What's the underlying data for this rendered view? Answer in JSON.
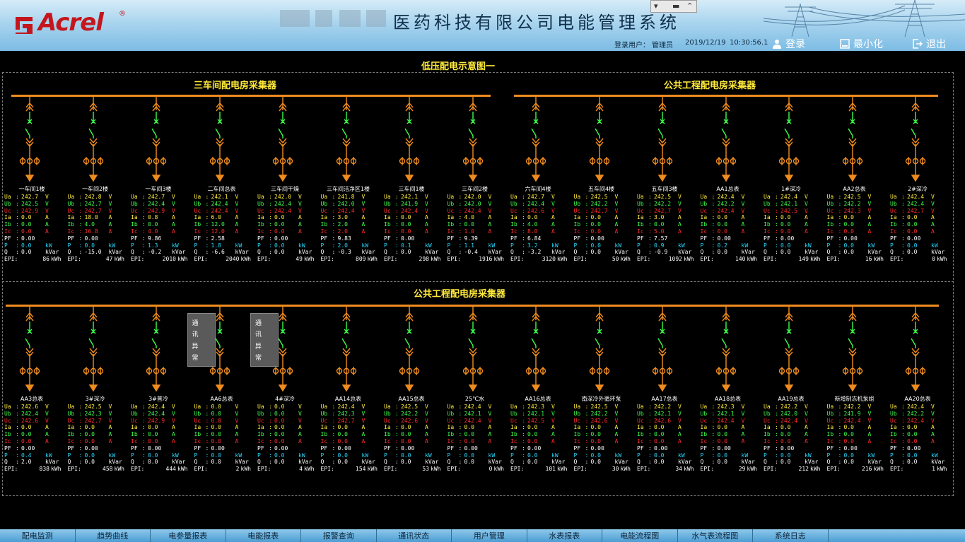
{
  "header": {
    "logo_text": "Acrel",
    "logo_mark": "®",
    "app_title": "医药科技有限公司电能管理系统",
    "login_user_label": "登录用户：",
    "login_user": "管理员",
    "date": "2019/12/19",
    "time": "10:30:56.1",
    "login_button": "登录",
    "minimize_button": "最小化",
    "exit_button": "退出"
  },
  "page_title": "低压配电示意图一",
  "sections": [
    {
      "title": "三车间配电房采集器"
    },
    {
      "title": "公共工程配电房采集器"
    },
    {
      "title": "公共工程配电房采集器"
    }
  ],
  "alert_text": [
    "通",
    "讯",
    "异",
    "常"
  ],
  "labels": {
    "ua": "Ua",
    "ub": "Ub",
    "uc": "Uc",
    "ia": "Ia",
    "ib": "Ib",
    "ic": "Ic",
    "pf": "PF",
    "p": "P",
    "q": "Q",
    "epi": "EPI:",
    "v": "V",
    "a": "A",
    "kw": "kW",
    "kvar": "kVar",
    "kwh": "kWh"
  },
  "row1": [
    {
      "name": "一车间1楼",
      "ua": "242.7",
      "ub": "242.5",
      "uc": "242.9",
      "ia": "0.0",
      "ib": "0.0",
      "ic": "0.0",
      "pf": "0.00",
      "p": "0.0",
      "q": "0.0",
      "epi": "86"
    },
    {
      "name": "一车间2楼",
      "ua": "242.8",
      "ub": "242.7",
      "uc": "242.7",
      "ia": "18.0",
      "ib": "4.0",
      "ic": "16.8",
      "pf": "0.00",
      "p": "0.0",
      "q": "-15.0",
      "epi": "47"
    },
    {
      "name": "一车间3楼",
      "ua": "242.7",
      "ub": "242.4",
      "uc": "242.9",
      "ia": "0.8",
      "ib": "0.0",
      "ic": "4.0",
      "pf": "9.86",
      "p": "1.3",
      "q": "-0.2",
      "epi": "2010"
    },
    {
      "name": "二车间总表",
      "ua": "242.1",
      "ub": "242.4",
      "uc": "242.4",
      "ia": "6.0",
      "ib": "12.0",
      "ic": "12.0",
      "pf": "2.58",
      "p": "1.8",
      "q": "-6.6",
      "epi": "2040"
    },
    {
      "name": "三车间干燥",
      "ua": "242.0",
      "ub": "242.4",
      "uc": "242.4",
      "ia": "0.0",
      "ib": "0.0",
      "ic": "0.0",
      "pf": "0.00",
      "p": "0.0",
      "q": "0.0",
      "epi": "49"
    },
    {
      "name": "三车间洁净区1楼",
      "ua": "241.8",
      "ub": "242.0",
      "uc": "242.4",
      "ia": "3.0",
      "ib": "2.0",
      "ic": "2.0",
      "pf": "9.83",
      "p": "2.0",
      "q": "-0.3",
      "epi": "809"
    },
    {
      "name": "三车间1楼",
      "ua": "242.1",
      "ub": "241.9",
      "uc": "242.4",
      "ia": "0.0",
      "ib": "0.0",
      "ic": "0.0",
      "pf": "0.00",
      "p": "0.1",
      "q": "0.0",
      "epi": "298"
    },
    {
      "name": "三车间2楼",
      "ua": "242.0",
      "ub": "242.0",
      "uc": "242.4",
      "ia": "4.0",
      "ib": "0.0",
      "ic": "1.0",
      "pf": "9.39",
      "p": "1.1",
      "q": "-0.4",
      "epi": "1916"
    },
    {
      "name": "六车间4楼",
      "ua": "242.7",
      "ub": "242.4",
      "uc": "242.6",
      "ia": "0.0",
      "ib": "4.0",
      "ic": "8.0",
      "pf": "6.84",
      "p": "3.2",
      "q": "-3.2",
      "epi": "3120"
    },
    {
      "name": "五车间4楼",
      "ua": "242.5",
      "ub": "242.2",
      "uc": "242.7",
      "ia": "0.0",
      "ib": "0.0",
      "ic": "0.0",
      "pf": "0.00",
      "p": "0.0",
      "q": "0.0",
      "epi": "50"
    },
    {
      "name": "五车间3楼",
      "ua": "242.5",
      "ub": "242.2",
      "uc": "242.7",
      "ia": "3.0",
      "ib": "0.0",
      "ic": "5.0",
      "pf": "7.57",
      "p": "0.9",
      "q": "-0.9",
      "epi": "1092"
    },
    {
      "name": "AA1总表",
      "ua": "242.4",
      "ub": "242.2",
      "uc": "242.4",
      "ia": "0.0",
      "ib": "0.0",
      "ic": "0.0",
      "pf": "0.00",
      "p": "0.2",
      "q": "0.0",
      "epi": "140"
    },
    {
      "name": "1#深冷",
      "ua": "242.4",
      "ub": "242.1",
      "uc": "242.5",
      "ia": "0.0",
      "ib": "0.0",
      "ic": "0.0",
      "pf": "0.00",
      "p": "0.0",
      "q": "0.0",
      "epi": "149"
    },
    {
      "name": "AA2总表",
      "ua": "242.5",
      "ub": "242.2",
      "uc": "242.3",
      "ia": "0.0",
      "ib": "0.0",
      "ic": "0.0",
      "pf": "0.00",
      "p": "0.0",
      "q": "0.0",
      "epi": "16"
    },
    {
      "name": "2#深冷",
      "ua": "242.4",
      "ub": "242.4",
      "uc": "242.7",
      "ia": "0.0",
      "ib": "0.0",
      "ic": "0.0",
      "pf": "0.00",
      "p": "0.0",
      "q": "0.0",
      "epi": "0"
    }
  ],
  "row2": [
    {
      "name": "AA3总表",
      "ua": "242.6",
      "ub": "242.4",
      "uc": "242.6",
      "ia": "0.0",
      "ib": "0.0",
      "ic": "0.0",
      "pf": "0.00",
      "p": "0.4",
      "q": "2.0",
      "epi": "838"
    },
    {
      "name": "3#深冷",
      "ua": "242.5",
      "ub": "242.3",
      "uc": "242.7",
      "ia": "0.0",
      "ib": "0.0",
      "ic": "0.0",
      "pf": "0.00",
      "p": "0.0",
      "q": "0.0",
      "epi": "458"
    },
    {
      "name": "3#普冷",
      "ua": "242.4",
      "ub": "242.4",
      "uc": "242.9",
      "ia": "0.0",
      "ib": "0.0",
      "ic": "0.0",
      "pf": "0.00",
      "p": "0.0",
      "q": "0.0",
      "epi": "444"
    },
    {
      "name": "AA6总表",
      "ua": "0.0",
      "ub": "0.0",
      "uc": "0.0",
      "ia": "0.0",
      "ib": "0.0",
      "ic": "0.0",
      "pf": "0.00",
      "p": "0.0",
      "q": "0.0",
      "epi": "2",
      "alert": true
    },
    {
      "name": "4#深冷",
      "ua": "0.0",
      "ub": "0.0",
      "uc": "0.0",
      "ia": "0.0",
      "ib": "0.0",
      "ic": "0.0",
      "pf": "0.00",
      "p": "0.0",
      "q": "0.0",
      "epi": "4",
      "alert": true
    },
    {
      "name": "AA14总表",
      "ua": "242.4",
      "ub": "242.3",
      "uc": "242.7",
      "ia": "0.0",
      "ib": "0.0",
      "ic": "0.0",
      "pf": "0.00",
      "p": "0.0",
      "q": "0.0",
      "epi": "154"
    },
    {
      "name": "AA15总表",
      "ua": "242.5",
      "ub": "242.2",
      "uc": "242.6",
      "ia": "0.0",
      "ib": "0.0",
      "ic": "0.0",
      "pf": "0.00",
      "p": "0.0",
      "q": "0.0",
      "epi": "53"
    },
    {
      "name": "25℃水",
      "ua": "242.4",
      "ub": "242.1",
      "uc": "242.4",
      "ia": "0.0",
      "ib": "0.0",
      "ic": "0.0",
      "pf": "0.00",
      "p": "0.0",
      "q": "0.0",
      "epi": "0"
    },
    {
      "name": "AA16总表",
      "ua": "242.3",
      "ub": "242.1",
      "uc": "242.5",
      "ia": "0.0",
      "ib": "0.0",
      "ic": "0.0",
      "pf": "0.00",
      "p": "0.0",
      "q": "0.0",
      "epi": "101"
    },
    {
      "name": "南深冷外循环泵",
      "ua": "242.5",
      "ub": "242.2",
      "uc": "242.6",
      "ia": "0.0",
      "ib": "0.0",
      "ic": "0.0",
      "pf": "0.00",
      "p": "0.0",
      "q": "0.0",
      "epi": "30"
    },
    {
      "name": "AA17总表",
      "ua": "242.2",
      "ub": "242.1",
      "uc": "242.6",
      "ia": "0.0",
      "ib": "0.0",
      "ic": "0.0",
      "pf": "0.00",
      "p": "0.0",
      "q": "0.0",
      "epi": "34"
    },
    {
      "name": "AA18总表",
      "ua": "242.3",
      "ub": "242.1",
      "uc": "242.4",
      "ia": "0.0",
      "ib": "0.0",
      "ic": "0.0",
      "pf": "0.00",
      "p": "0.0",
      "q": "0.0",
      "epi": "29"
    },
    {
      "name": "AA19总表",
      "ua": "242.2",
      "ub": "242.0",
      "uc": "242.4",
      "ia": "0.0",
      "ib": "0.0",
      "ic": "0.0",
      "pf": "0.00",
      "p": "0.0",
      "q": "0.0",
      "epi": "212"
    },
    {
      "name": "新增制冻机泵组",
      "ua": "242.2",
      "ub": "241.9",
      "uc": "242.4",
      "ia": "0.0",
      "ib": "0.0",
      "ic": "0.0",
      "pf": "0.00",
      "p": "0.0",
      "q": "0.0",
      "epi": "216"
    },
    {
      "name": "AA20总表",
      "ua": "242.4",
      "ub": "242.2",
      "uc": "242.4",
      "ia": "0.0",
      "ib": "0.0",
      "ic": "0.0",
      "pf": "0.00",
      "p": "0.0",
      "q": "0.0",
      "epi": "1"
    }
  ],
  "nav": [
    "配电监测",
    "趋势曲线",
    "电参量报表",
    "电能报表",
    "报警查询",
    "通讯状态",
    "用户管理",
    "水表报表",
    "电能流程图",
    "水气表流程图",
    "系统日志"
  ],
  "colors": {
    "bus": "#f08c1e",
    "breaker": "#3dff4a",
    "title": "#ffea3a",
    "ua": "#ffec3d",
    "ub": "#3dff4a",
    "uc": "#ff2c2c",
    "pq": "#24d9ff"
  }
}
